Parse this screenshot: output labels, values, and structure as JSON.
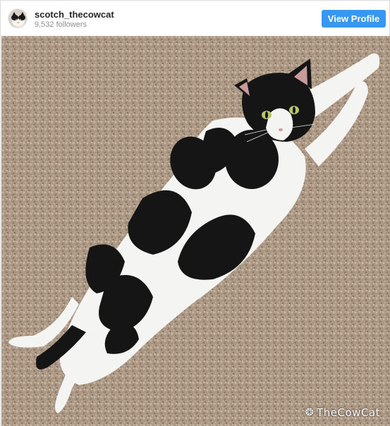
{
  "profile": {
    "username": "scotch_thecowcat",
    "followers": "9,532 followers",
    "view_profile_label": "View Profile"
  },
  "photo": {
    "subject": "cat-photo",
    "watermark_text": "TheCowCat",
    "watermark_icon": "paw-icon"
  },
  "colors": {
    "button": "#3897f0",
    "carpet": "#a89480",
    "fur_white": "#f4f4f2",
    "fur_black": "#151515",
    "eyes": "#b8c46a"
  }
}
